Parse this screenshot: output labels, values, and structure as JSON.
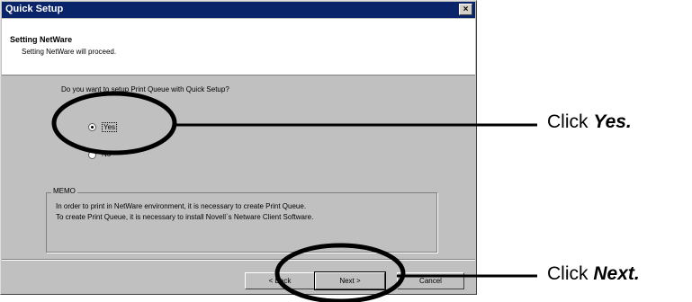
{
  "window": {
    "title": "Quick Setup",
    "close_glyph": "×"
  },
  "header": {
    "title": "Setting NetWare",
    "subtitle": "Setting NetWare will proceed."
  },
  "question": "Do you want to setup Print Queue with Quick Setup?",
  "options": [
    {
      "label": "Yes",
      "selected": true
    },
    {
      "label": "No",
      "selected": false
    }
  ],
  "memo": {
    "legend": "MEMO",
    "lines": [
      "In order to print in NetWare environment, it is necessary to create Print Queue.",
      "To create Print Queue, it is necessary to install Novell`s Netware Client Software."
    ]
  },
  "buttons": {
    "back": "< Back",
    "next": "Next >",
    "cancel": "Cancel"
  },
  "callouts": {
    "yes": {
      "prefix": "Click ",
      "emph": "Yes."
    },
    "next": {
      "prefix": "Click ",
      "emph": "Next."
    }
  }
}
